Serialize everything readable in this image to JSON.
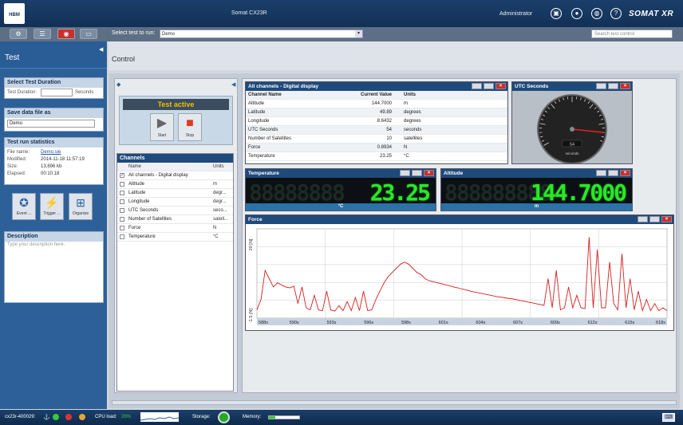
{
  "topbar": {
    "logo": "HBM",
    "app_title": "Somat CX23R",
    "user": "Administrator",
    "brand": "SOMAT XR"
  },
  "toolbar": {
    "select_label": "Select test to run:",
    "selected_test": "Demo",
    "search_placeholder": "Search test control"
  },
  "sidebar": {
    "title": "Test",
    "duration": {
      "header": "Select Test Duration",
      "label": "Test Duration:",
      "value": "",
      "unit": "Seconds"
    },
    "save": {
      "header": "Save data file as",
      "value": "Demo"
    },
    "stats": {
      "header": "Test run statistics",
      "rows": [
        {
          "label": "File name:",
          "value": "Demo.sie"
        },
        {
          "label": "Modified:",
          "value": "2014-11-18 11:57:19"
        },
        {
          "label": "Size:",
          "value": "13,696 kb"
        },
        {
          "label": "Elapsed:",
          "value": "00:10:18"
        }
      ]
    },
    "buttons": [
      {
        "label": "Event ..."
      },
      {
        "label": "Trigger ..."
      },
      {
        "label": "Organize"
      }
    ],
    "description": {
      "header": "Description",
      "placeholder": "Type your description here."
    }
  },
  "main": {
    "title": "Control"
  },
  "control": {
    "status": "Test active",
    "start_label": "Start",
    "stop_label": "Stop"
  },
  "channels": {
    "header": "Channels",
    "col_name": "Name",
    "col_units": "Units",
    "rows": [
      {
        "name": "All channels - Digital display",
        "units": "",
        "checked": true
      },
      {
        "name": "Altitude",
        "units": "m",
        "checked": false
      },
      {
        "name": "Latitude",
        "units": "degr...",
        "checked": false
      },
      {
        "name": "Longitude",
        "units": "degr...",
        "checked": false
      },
      {
        "name": "UTC Seconds",
        "units": "seco...",
        "checked": false
      },
      {
        "name": "Number of Satellites",
        "units": "satell...",
        "checked": false
      },
      {
        "name": "Force",
        "units": "N",
        "checked": false
      },
      {
        "name": "Temperature",
        "units": "°C",
        "checked": false
      }
    ]
  },
  "digital": {
    "title": "All channels - Digital display",
    "col_name": "Channel Name",
    "col_value": "Current Value",
    "col_units": "Units",
    "rows": [
      {
        "name": "Altitude",
        "value": "144.7000",
        "units": "m"
      },
      {
        "name": "Latitude",
        "value": "49.89",
        "units": "degrees"
      },
      {
        "name": "Longitude",
        "value": "8.6432",
        "units": "degrees"
      },
      {
        "name": "UTC Seconds",
        "value": "54",
        "units": "seconds"
      },
      {
        "name": "Number of Satellites",
        "value": "10",
        "units": "satellites"
      },
      {
        "name": "Force",
        "value": "0.8934",
        "units": "N"
      },
      {
        "name": "Temperature",
        "value": "23.25",
        "units": "°C"
      }
    ]
  },
  "gauge": {
    "title": "UTC Seconds",
    "value": "54",
    "unit": "seconds"
  },
  "temperature": {
    "title": "Temperature",
    "value": "23.25",
    "ghost": "88888888",
    "unit": "°C"
  },
  "altitude": {
    "title": "Altitude",
    "value": "144.7000",
    "ghost": "888888888",
    "unit": "m"
  },
  "chart_data": {
    "type": "line",
    "title": "Force",
    "ylabel_top": "20 [N]",
    "ylabel_bottom": "-1.5 [N]",
    "x_ticks": [
      "588s",
      "590s",
      "593s",
      "596s",
      "598s",
      "601s",
      "604s",
      "607s",
      "609s",
      "612s",
      "615s",
      "618s"
    ],
    "xlim": [
      588,
      618
    ],
    "ylim": [
      -1.5,
      20
    ],
    "grid": true,
    "series": [
      {
        "color": "#d42020",
        "x": [
          588.0,
          588.3,
          588.6,
          588.9,
          589.2,
          589.5,
          589.8,
          590.1,
          590.4,
          590.7,
          591.0,
          591.3,
          591.6,
          591.9,
          592.2,
          592.5,
          592.8,
          593.1,
          593.4,
          593.7,
          594.0,
          594.3,
          594.6,
          594.9,
          595.2,
          595.5,
          595.8,
          596.1,
          596.4,
          596.7,
          597.0,
          597.3,
          597.6,
          597.9,
          598.2,
          598.5,
          598.8,
          599.1,
          599.4,
          599.7,
          600.0,
          600.3,
          600.6,
          600.9,
          601.2,
          601.5,
          601.8,
          602.1,
          602.4,
          602.7,
          603.0,
          603.3,
          603.6,
          603.9,
          604.2,
          604.5,
          604.8,
          605.1,
          605.4,
          605.7,
          606.0,
          606.3,
          606.6,
          606.9,
          607.2,
          607.5,
          607.8,
          608.1,
          608.4,
          608.7,
          609.0,
          609.3,
          609.6,
          609.9,
          610.2,
          610.5,
          610.8,
          611.1,
          611.4,
          611.7,
          612.0,
          612.3,
          612.6,
          612.9,
          613.2,
          613.5,
          613.8,
          614.1,
          614.4,
          614.7,
          615.0,
          615.3,
          615.6,
          615.9,
          616.2,
          616.5,
          616.8,
          617.1,
          617.4,
          617.7,
          618.0
        ],
        "y": [
          0.5,
          3,
          10,
          8,
          6,
          7,
          6.5,
          6,
          5.8,
          6.2,
          2,
          6,
          1,
          0.5,
          4,
          0.5,
          0.3,
          5,
          0.5,
          0.2,
          1.5,
          0.3,
          2.5,
          0.3,
          3.5,
          0.3,
          5,
          0.3,
          0.5,
          3,
          5,
          7,
          8.5,
          9.5,
          10.5,
          11.5,
          12,
          11.5,
          10.5,
          9.5,
          9,
          8,
          7.5,
          7.3,
          7,
          6.8,
          6.5,
          6.3,
          6,
          5.8,
          5.5,
          5.3,
          5,
          4.8,
          4.6,
          4.4,
          4.2,
          4,
          3.8,
          3.6,
          3.5,
          3.3,
          3.2,
          3,
          2.8,
          2.6,
          2.4,
          2.2,
          2,
          1.8,
          1.6,
          8,
          1,
          10,
          0.5,
          1,
          6,
          1,
          4,
          1,
          0.8,
          18,
          1,
          15,
          1,
          1,
          12,
          2,
          0.5,
          14,
          1,
          8,
          0.5,
          5,
          0.3,
          3,
          0.3,
          2,
          0.3,
          1,
          0.3
        ]
      }
    ]
  },
  "statusbar": {
    "device": "cx23r-400029:",
    "cpu_label": "CPU load:",
    "cpu_value": "26%",
    "storage_label": "Storage:",
    "memory_label": "Memory:"
  }
}
